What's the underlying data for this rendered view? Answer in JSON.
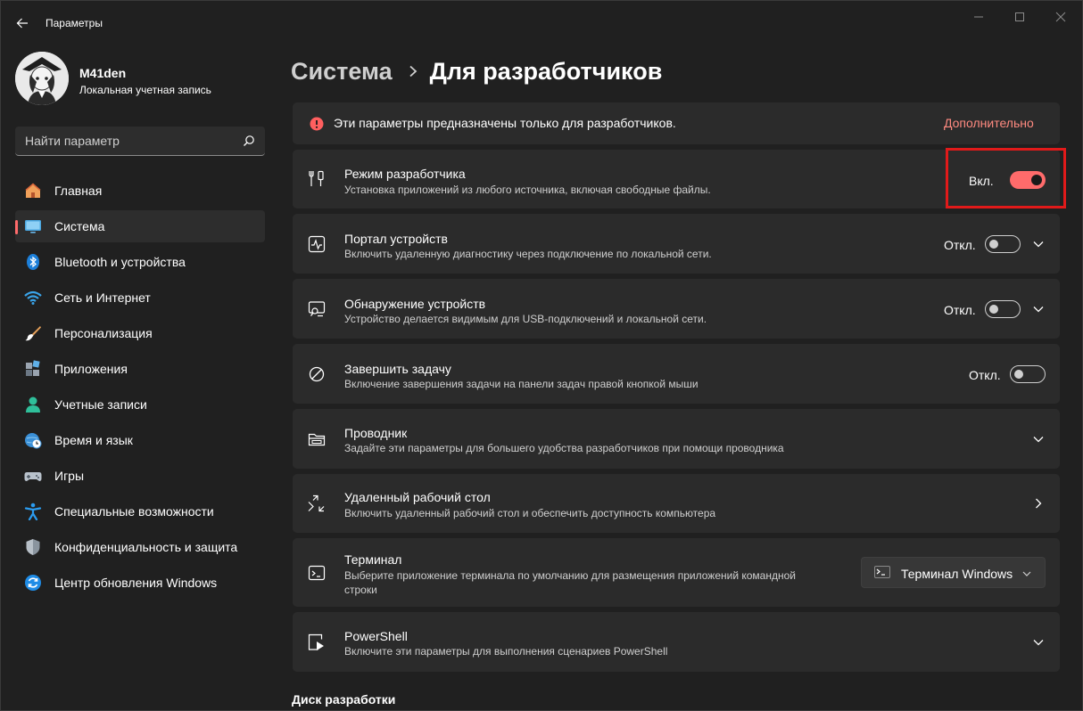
{
  "window": {
    "title": "Параметры"
  },
  "profile": {
    "name": "M41den",
    "account_type": "Локальная учетная запись"
  },
  "search": {
    "placeholder": "Найти параметр"
  },
  "sidebar": {
    "items": [
      {
        "label": "Главная",
        "icon": "home-icon"
      },
      {
        "label": "Система",
        "icon": "system-icon",
        "active": true
      },
      {
        "label": "Bluetooth и устройства",
        "icon": "bluetooth-icon"
      },
      {
        "label": "Сеть и Интернет",
        "icon": "wifi-icon"
      },
      {
        "label": "Персонализация",
        "icon": "brush-icon"
      },
      {
        "label": "Приложения",
        "icon": "apps-icon"
      },
      {
        "label": "Учетные записи",
        "icon": "accounts-icon"
      },
      {
        "label": "Время и язык",
        "icon": "globe-clock-icon"
      },
      {
        "label": "Игры",
        "icon": "gamepad-icon"
      },
      {
        "label": "Специальные возможности",
        "icon": "accessibility-icon"
      },
      {
        "label": "Конфиденциальность и защита",
        "icon": "shield-icon"
      },
      {
        "label": "Центр обновления Windows",
        "icon": "update-icon"
      }
    ]
  },
  "breadcrumb": {
    "parent": "Система",
    "current": "Для разработчиков"
  },
  "banner": {
    "text": "Эти параметры предназначены только для разработчиков.",
    "link": "Дополнительно"
  },
  "settings": {
    "dev_mode": {
      "title": "Режим разработчика",
      "desc": "Установка приложений из любого источника, включая свободные файлы.",
      "state": "Вкл.",
      "on": true
    },
    "device_portal": {
      "title": "Портал устройств",
      "desc": "Включить удаленную диагностику через подключение по локальной сети.",
      "state": "Откл.",
      "on": false
    },
    "device_discovery": {
      "title": "Обнаружение устройств",
      "desc": "Устройство делается видимым для USB-подключений и локальной сети.",
      "state": "Откл.",
      "on": false
    },
    "end_task": {
      "title": "Завершить задачу",
      "desc": "Включение завершения задачи на панели задач правой кнопкой мыши",
      "state": "Откл.",
      "on": false
    },
    "explorer": {
      "title": "Проводник",
      "desc": "Задайте эти параметры для большего удобства разработчиков при помощи проводника"
    },
    "remote_desktop": {
      "title": "Удаленный рабочий стол",
      "desc": "Включить удаленный рабочий стол и обеспечить доступность компьютера"
    },
    "terminal": {
      "title": "Терминал",
      "desc": "Выберите приложение терминала по умолчанию для размещения приложений командной строки",
      "selected": "Терминал Windows"
    },
    "powershell": {
      "title": "PowerShell",
      "desc": "Включите эти параметры для выполнения сценариев PowerShell"
    }
  },
  "section_heading": "Диск разработки",
  "colors": {
    "accent": "#ff6b6b",
    "highlight_box": "#e11a1a",
    "card_bg": "#2b2b2b",
    "window_bg": "#202020"
  }
}
